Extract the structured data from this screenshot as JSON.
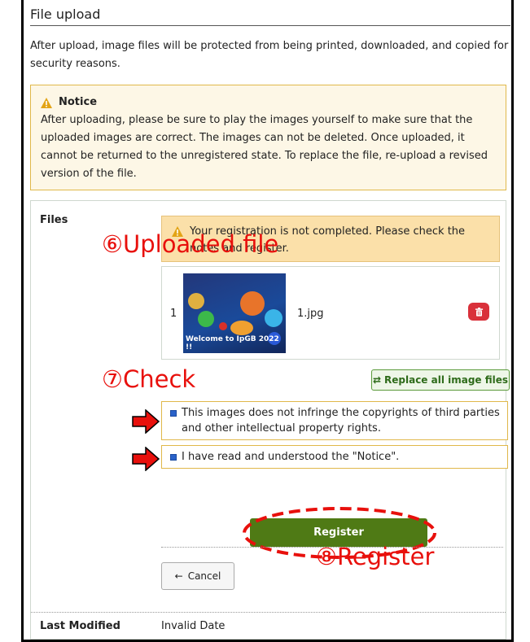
{
  "page": {
    "title": "File upload",
    "description": "After upload, image files will be protected from being printed, downloaded, and copied for security reasons."
  },
  "notice": {
    "heading": "Notice",
    "body": "After uploading, please be sure to play the images yourself to make sure that the uploaded images are correct. The images can not be deleted. Once uploaded, it cannot be returned to the unregistered state. To replace the file, re-upload a revised version of the file."
  },
  "files_section": {
    "label": "Files",
    "alert": "Your registration is not completed. Please check the notes and register.",
    "files": [
      {
        "index": "1",
        "name": "1.jpg",
        "thumbnail_caption": "Welcome to IpGB 2022 !!"
      }
    ],
    "replace_button": "Replace all image files",
    "checks": [
      {
        "label": "This images does not infringe the copyrights of third parties and other intellectual property rights.",
        "checked": true
      },
      {
        "label": "I have read and understood the \"Notice\".",
        "checked": true
      }
    ],
    "register_button": "Register",
    "cancel_button": "Cancel"
  },
  "last_modified": {
    "label": "Last Modified",
    "value": "Invalid Date"
  },
  "annotations": {
    "uploaded": "⑥Uploaded file",
    "check": "⑦Check",
    "register": "⑧Register",
    "color": "#e8100c"
  },
  "colors": {
    "register": "#4f7a15",
    "notice_bg": "#fdf7e6",
    "alert_bg": "#fbe0a9",
    "delete": "#d9303a"
  },
  "icons": {
    "warning": "warning-icon",
    "delete": "trash-icon",
    "replace": "swap-arrows-icon",
    "cancel": "arrow-left-icon",
    "checkbox": "checkbox-checked-icon",
    "pointer": "red-arrow-icon"
  }
}
